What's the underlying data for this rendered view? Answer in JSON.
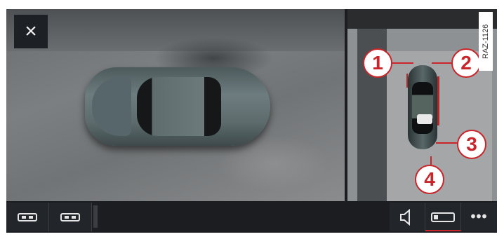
{
  "close_label": "×",
  "side_view": {
    "callouts": [
      "1",
      "2",
      "3",
      "4"
    ],
    "image_code": "RAZ-1126"
  },
  "toolbar": {
    "buttons": [
      {
        "icon": "rear-camera-view-icon"
      },
      {
        "icon": "top-view-camera-icon"
      },
      {
        "icon": "speaker-mute-icon"
      },
      {
        "icon": "camera-view-toggle-icon"
      },
      {
        "icon": "more-options-icon",
        "label": "•••"
      }
    ]
  },
  "colors": {
    "callout_red": "#c9252b",
    "toolbar_bg": "#1b1d20"
  }
}
